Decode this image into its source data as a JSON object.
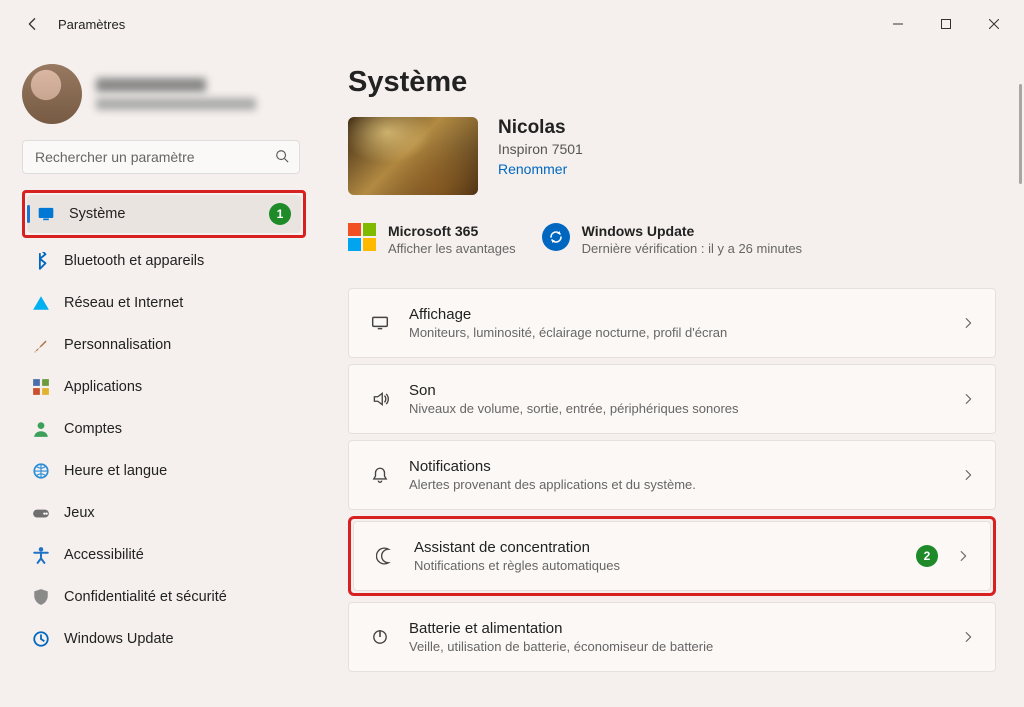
{
  "window": {
    "title": "Paramètres"
  },
  "search": {
    "placeholder": "Rechercher un paramètre"
  },
  "sidebar": {
    "items": [
      {
        "label": "Système",
        "icon": "monitor-icon",
        "color": "#0078d4",
        "selected": true,
        "highlight_badge": "1"
      },
      {
        "label": "Bluetooth et appareils",
        "icon": "bluetooth-icon",
        "color": "#0067c0"
      },
      {
        "label": "Réseau et Internet",
        "icon": "wifi-icon",
        "color": "#00b0f0"
      },
      {
        "label": "Personnalisation",
        "icon": "brush-icon",
        "color": "#b57a4a"
      },
      {
        "label": "Applications",
        "icon": "apps-icon",
        "color": "#4a6ea9"
      },
      {
        "label": "Comptes",
        "icon": "person-icon",
        "color": "#3ca05a"
      },
      {
        "label": "Heure et langue",
        "icon": "clock-globe-icon",
        "color": "#2a8dd8"
      },
      {
        "label": "Jeux",
        "icon": "gamepad-icon",
        "color": "#6f6f6f"
      },
      {
        "label": "Accessibilité",
        "icon": "accessibility-icon",
        "color": "#1f73c7"
      },
      {
        "label": "Confidentialité et sécurité",
        "icon": "shield-icon",
        "color": "#8a8a8a"
      },
      {
        "label": "Windows Update",
        "icon": "update-icon",
        "color": "#0067c0"
      }
    ]
  },
  "page": {
    "heading": "Système"
  },
  "device": {
    "name": "Nicolas",
    "model": "Inspiron 7501",
    "rename_label": "Renommer"
  },
  "quicklinks": {
    "m365": {
      "title": "Microsoft 365",
      "subtitle": "Afficher les avantages"
    },
    "wu": {
      "title": "Windows Update",
      "subtitle": "Dernière vérification : il y a 26 minutes"
    }
  },
  "cards": [
    {
      "title": "Affichage",
      "subtitle": "Moniteurs, luminosité, éclairage nocturne, profil d'écran",
      "icon": "display-icon"
    },
    {
      "title": "Son",
      "subtitle": "Niveaux de volume, sortie, entrée, périphériques sonores",
      "icon": "sound-icon"
    },
    {
      "title": "Notifications",
      "subtitle": "Alertes provenant des applications et du système.",
      "icon": "bell-icon"
    },
    {
      "title": "Assistant de concentration",
      "subtitle": "Notifications et règles automatiques",
      "icon": "moon-icon",
      "highlight_badge": "2"
    },
    {
      "title": "Batterie et alimentation",
      "subtitle": "Veille, utilisation de batterie, économiseur de batterie",
      "icon": "power-icon"
    }
  ]
}
